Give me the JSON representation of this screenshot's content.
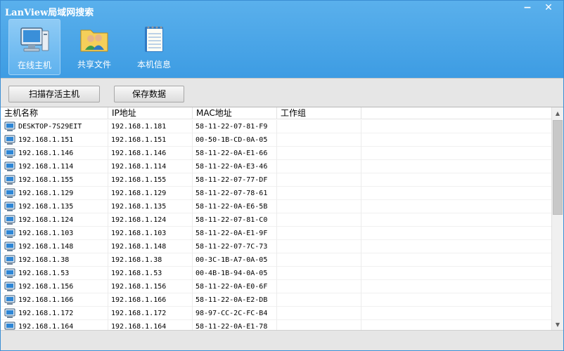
{
  "window": {
    "title": "LanView局域网搜索",
    "min_glyph": "−",
    "close_glyph": "✕"
  },
  "nav": [
    {
      "label": "在线主机",
      "icon": "computer-icon",
      "active": true
    },
    {
      "label": "共享文件",
      "icon": "shared-users-icon",
      "active": false
    },
    {
      "label": "本机信息",
      "icon": "notepad-icon",
      "active": false
    }
  ],
  "toolbar": {
    "scan_label": "扫描存活主机",
    "save_label": "保存数据"
  },
  "table": {
    "columns": [
      "主机名称",
      "IP地址",
      "MAC地址",
      "工作组"
    ],
    "rows": [
      [
        "DESKTOP-7S29EIT",
        "192.168.1.181",
        "58-11-22-07-81-F9",
        ""
      ],
      [
        "192.168.1.151",
        "192.168.1.151",
        "00-50-1B-CD-0A-05",
        ""
      ],
      [
        "192.168.1.146",
        "192.168.1.146",
        "58-11-22-0A-E1-66",
        ""
      ],
      [
        "192.168.1.114",
        "192.168.1.114",
        "58-11-22-0A-E3-46",
        ""
      ],
      [
        "192.168.1.155",
        "192.168.1.155",
        "58-11-22-07-77-DF",
        ""
      ],
      [
        "192.168.1.129",
        "192.168.1.129",
        "58-11-22-07-78-61",
        ""
      ],
      [
        "192.168.1.135",
        "192.168.1.135",
        "58-11-22-0A-E6-5B",
        ""
      ],
      [
        "192.168.1.124",
        "192.168.1.124",
        "58-11-22-07-81-C0",
        ""
      ],
      [
        "192.168.1.103",
        "192.168.1.103",
        "58-11-22-0A-E1-9F",
        ""
      ],
      [
        "192.168.1.148",
        "192.168.1.148",
        "58-11-22-07-7C-73",
        ""
      ],
      [
        "192.168.1.38",
        "192.168.1.38",
        "00-3C-1B-A7-0A-05",
        ""
      ],
      [
        "192.168.1.53",
        "192.168.1.53",
        "00-4B-1B-94-0A-05",
        ""
      ],
      [
        "192.168.1.156",
        "192.168.1.156",
        "58-11-22-0A-E0-6F",
        ""
      ],
      [
        "192.168.1.166",
        "192.168.1.166",
        "58-11-22-0A-E2-DB",
        ""
      ],
      [
        "192.168.1.172",
        "192.168.1.172",
        "98-97-CC-2C-FC-B4",
        ""
      ],
      [
        "192.168.1.164",
        "192.168.1.164",
        "58-11-22-0A-E1-78",
        ""
      ]
    ]
  },
  "colors": {
    "titlebar": "#4aa6e8",
    "active_tab": "#7cc0f2",
    "background": "#e6e6e6"
  }
}
